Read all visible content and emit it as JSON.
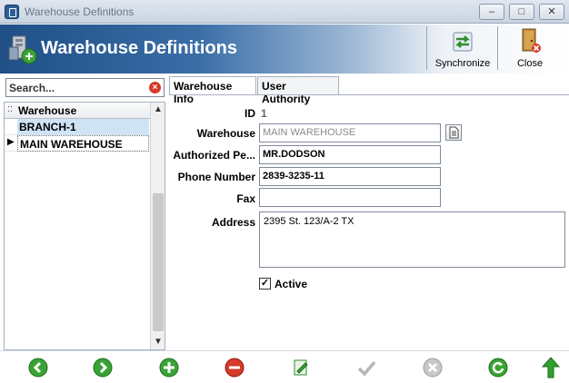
{
  "window": {
    "title": "Warehouse Definitions",
    "controls": {
      "minimize": "–",
      "maximize": "□",
      "close": "✕"
    }
  },
  "header": {
    "title": "Warehouse Definitions",
    "synchronize_label": "Synchronize",
    "close_label": "Close"
  },
  "search": {
    "placeholder": "Search..."
  },
  "grid": {
    "column": "Warehouse",
    "rows": [
      "BRANCH-1",
      "MAIN WAREHOUSE"
    ],
    "current_row_marker": "▶"
  },
  "tabs": [
    "Warehouse Info",
    "User Authority"
  ],
  "form": {
    "id_label": "ID",
    "id_value": "1",
    "warehouse_label": "Warehouse",
    "warehouse_value": "MAIN WAREHOUSE",
    "authorized_label": "Authorized Pe...",
    "authorized_value": "MR.DODSON",
    "phone_label": "Phone Number",
    "phone_value": "2839-3235-11",
    "fax_label": "Fax",
    "fax_value": "",
    "address_label": "Address",
    "address_value": "2395 St. 123/A-2 TX",
    "active_label": "Active",
    "active_checked": true
  },
  "bottom_buttons": [
    "previous-icon",
    "next-icon",
    "add-icon",
    "delete-icon",
    "edit-icon",
    "save-check-icon",
    "cancel-icon",
    "refresh-icon",
    "export-up-icon"
  ],
  "colors": {
    "banner_dark": "#1f4f86",
    "selected_row": "#cfe3f5",
    "nav_green": "#3aa335",
    "delete_red": "#d63a2a"
  }
}
